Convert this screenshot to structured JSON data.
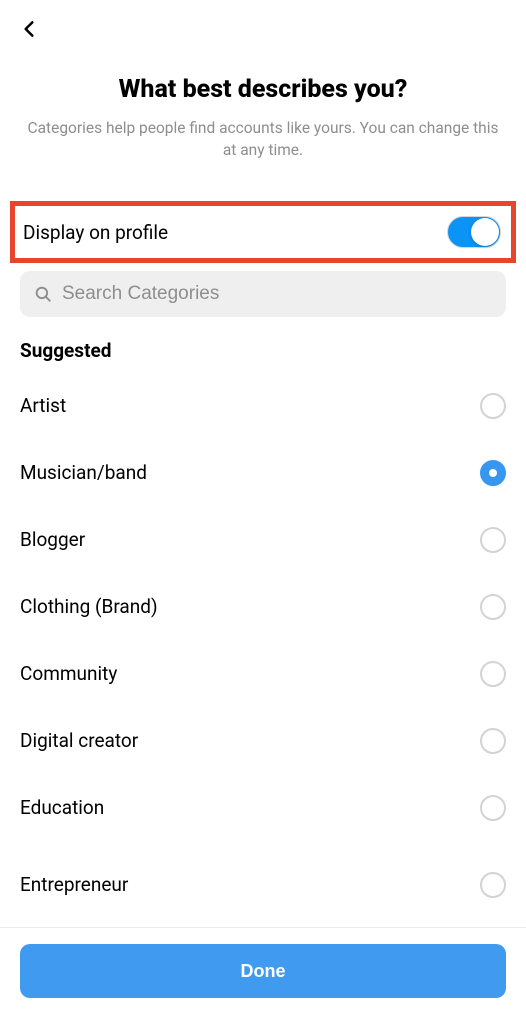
{
  "header": {
    "title": "What best describes you?",
    "subtitle": "Categories help people find accounts like yours. You can change this at any time."
  },
  "display_toggle": {
    "label": "Display on profile",
    "enabled": true
  },
  "search": {
    "placeholder": "Search Categories"
  },
  "section_title": "Suggested",
  "categories": [
    {
      "name": "Artist",
      "selected": false
    },
    {
      "name": "Musician/band",
      "selected": true
    },
    {
      "name": "Blogger",
      "selected": false
    },
    {
      "name": "Clothing (Brand)",
      "selected": false
    },
    {
      "name": "Community",
      "selected": false
    },
    {
      "name": "Digital creator",
      "selected": false
    },
    {
      "name": "Education",
      "selected": false
    },
    {
      "name": "Entrepreneur",
      "selected": false
    }
  ],
  "footer": {
    "done": "Done"
  },
  "colors": {
    "accent": "#3797f0",
    "highlight_border": "#e8452d"
  }
}
